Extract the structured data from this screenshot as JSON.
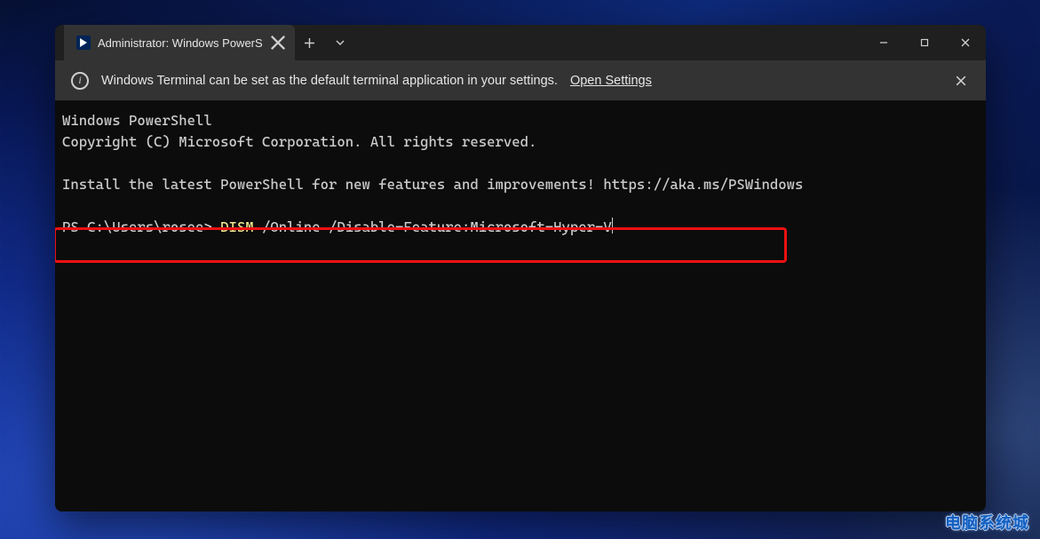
{
  "colors": {
    "terminal_bg": "#0c0c0c",
    "text": "#cccccc",
    "highlight_border": "#e11",
    "command_keyword": "#f0e68c",
    "titlebar_active": "#333333",
    "titlebar_inactive": "#1f1f1f"
  },
  "tab": {
    "title": "Administrator: Windows PowerS",
    "icon_name": "powershell-icon"
  },
  "infobar": {
    "message": "Windows Terminal can be set as the default terminal application in your settings.",
    "link_text": "Open Settings"
  },
  "terminal": {
    "lines": {
      "l1": "Windows PowerShell",
      "l2": "Copyright (C) Microsoft Corporation. All rights reserved.",
      "l3": "",
      "l4": "Install the latest PowerShell for new features and improvements! https://aka.ms/PSWindows",
      "l5": ""
    },
    "prompt": {
      "ps": "PS C:\\Users\\rosee> ",
      "cmd_keyword": "DISM",
      "cmd_rest": " /Online /Disable-Feature:Microsoft-Hyper-V"
    }
  },
  "watermark": "电脑系统城"
}
